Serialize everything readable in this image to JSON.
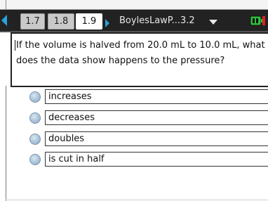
{
  "tabs": [
    {
      "label": "1.7",
      "active": false
    },
    {
      "label": "1.8",
      "active": false
    },
    {
      "label": "1.9",
      "active": true
    }
  ],
  "document": {
    "title": "BoylesLawP...3.2"
  },
  "icons": {
    "nav_left": "chevron-left-icon",
    "nav_right": "chevron-right-icon",
    "dropdown": "chevron-down-icon",
    "battery": "battery-icon"
  },
  "colors": {
    "tabbar_bg": "#222222",
    "nav_arrow": "#29a3dc",
    "battery_green": "#2fbf3a",
    "battery_red": "#e02020"
  },
  "question": {
    "text": "If the volume is halved from 20.0 mL to 10.0 mL, what does the data show happens to the pressure?"
  },
  "choices": [
    {
      "label": "increases"
    },
    {
      "label": "decreases"
    },
    {
      "label": "doubles"
    },
    {
      "label": "is cut in half"
    }
  ]
}
